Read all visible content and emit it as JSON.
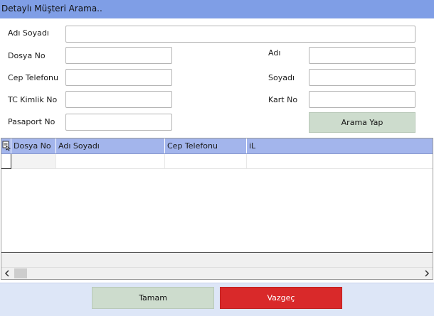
{
  "window": {
    "title": "Detaylı Müşteri Arama.."
  },
  "form": {
    "ad_soyadi_label": "Adı Soyadı",
    "ad_soyadi_value": "",
    "dosya_no_label": "Dosya No",
    "dosya_no_value": "",
    "cep_telefonu_label": "Cep Telefonu",
    "cep_telefonu_value": "",
    "tc_kimlik_label": "TC Kimlik No",
    "tc_kimlik_value": "",
    "pasaport_label": "Pasaport No",
    "pasaport_value": "",
    "adi_label": "Adı",
    "adi_value": "",
    "soyadi_label": "Soyadı",
    "soyadi_value": "",
    "kart_no_label": "Kart No",
    "kart_no_value": "",
    "search_button": "Arama Yap"
  },
  "grid": {
    "columns": [
      "Dosya No",
      "Adı Soyadı",
      "Cep Telefonu",
      "iL"
    ],
    "rows": [
      [
        "",
        "",
        "",
        ""
      ]
    ]
  },
  "footer": {
    "ok_button": "Tamam",
    "cancel_button": "Vazgeç"
  },
  "colors": {
    "titlebar": "#7f9ee6",
    "grid_header": "#a3b5ec",
    "green_button": "#cddccd",
    "red_button": "#d9292a"
  },
  "icons": {
    "grid_corner": "row-selector-icon",
    "scroll_left": "chevron-left-icon",
    "scroll_right": "chevron-right-icon"
  }
}
